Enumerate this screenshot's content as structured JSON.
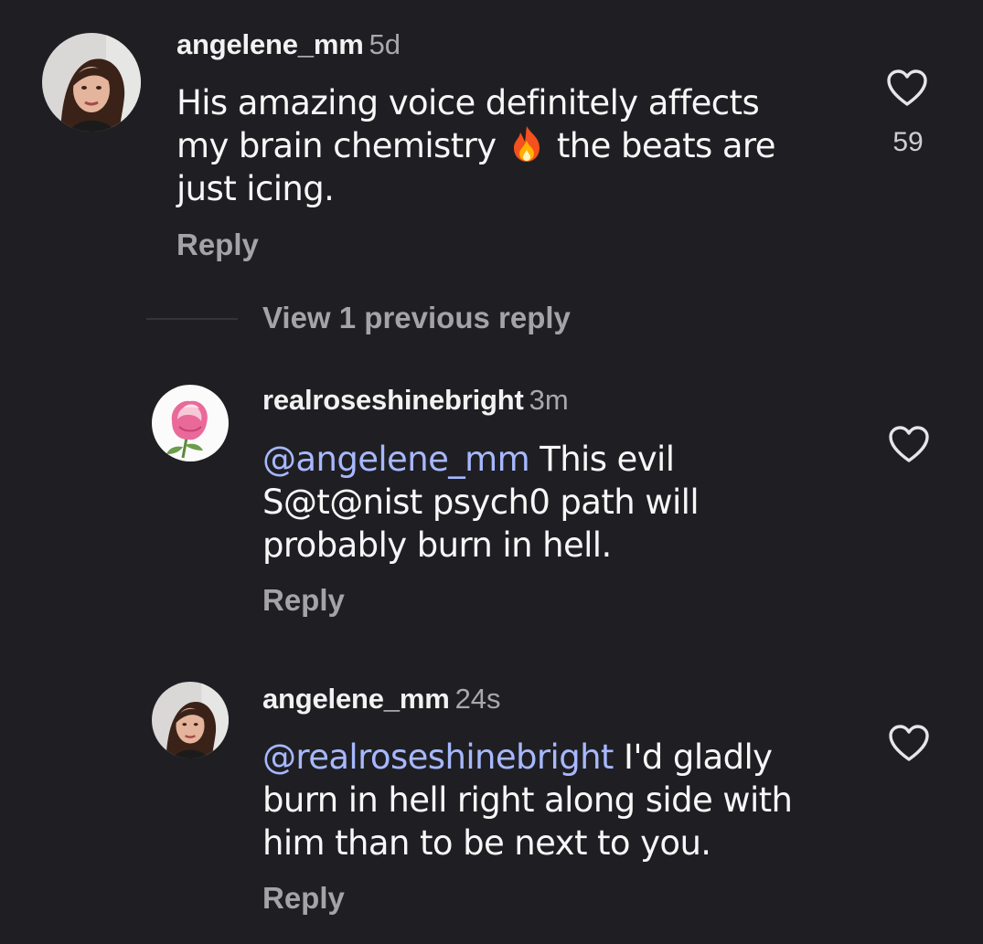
{
  "comments": [
    {
      "username": "angelene_mm",
      "time": "5d",
      "text_before": "His amazing voice definitely affects\nmy brain chemistry ",
      "emoji": "fire",
      "text_after": " the beats are\njust icing.",
      "reply_label": "Reply",
      "likes": "59",
      "avatar": "woman-portrait"
    },
    {
      "username": "realroseshinebright",
      "time": "3m",
      "mention": "@angelene_mm",
      "text": " This evil\nS@t@nist psych0 path will\nprobably burn in hell.",
      "reply_label": "Reply",
      "avatar": "pink-rose"
    },
    {
      "username": "angelene_mm",
      "time": "24s",
      "mention": "@realroseshinebright",
      "text": " I'd gladly\nburn in hell right along side with\nhim than to be next to you.",
      "reply_label": "Reply",
      "avatar": "woman-portrait"
    }
  ],
  "thread": {
    "view_previous_label": "View 1 previous reply"
  },
  "colors": {
    "background": "#1f1f23",
    "mention": "#a7b8ff",
    "muted": "#a3a3a8"
  },
  "icons": {
    "like": "heart-outline-icon",
    "fire": "fire-emoji"
  }
}
